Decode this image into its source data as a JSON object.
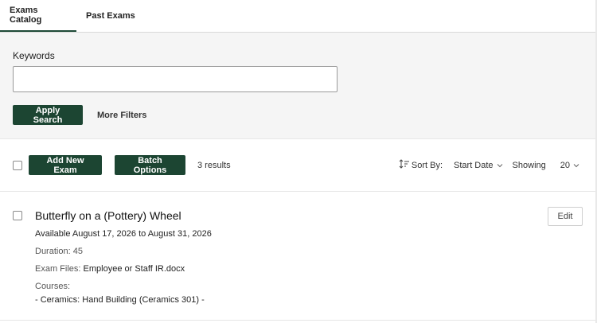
{
  "tabs": [
    {
      "label": "Exams Catalog",
      "active": true
    },
    {
      "label": "Past Exams",
      "active": false
    }
  ],
  "search": {
    "keywords_label": "Keywords",
    "keywords_value": "",
    "apply_label": "Apply Search",
    "more_filters_label": "More Filters"
  },
  "toolbar": {
    "add_label": "Add New Exam",
    "batch_label": "Batch Options",
    "results_text": "3 results",
    "sort_by_label": "Sort By:",
    "sort_value": "Start Date",
    "showing_label": "Showing",
    "showing_value": "20"
  },
  "exam": {
    "title": "Butterfly on a (Pottery) Wheel",
    "availability": "Available August 17, 2026 to August 31, 2026",
    "duration_label": "Duration:",
    "duration_value": "45",
    "files_label": "Exam Files:",
    "files_value": "Employee or Staff IR.docx",
    "courses_label": "Courses:",
    "courses_value": "- Ceramics: Hand Building (Ceramics 301) -",
    "edit_label": "Edit"
  },
  "colors": {
    "primary": "#1c4532",
    "tab_underline": "#1e4a37",
    "panel_bg": "#f5f5f5"
  },
  "icons": {
    "sort": "sort-order-icon",
    "chevron": "chevron-down-icon"
  }
}
